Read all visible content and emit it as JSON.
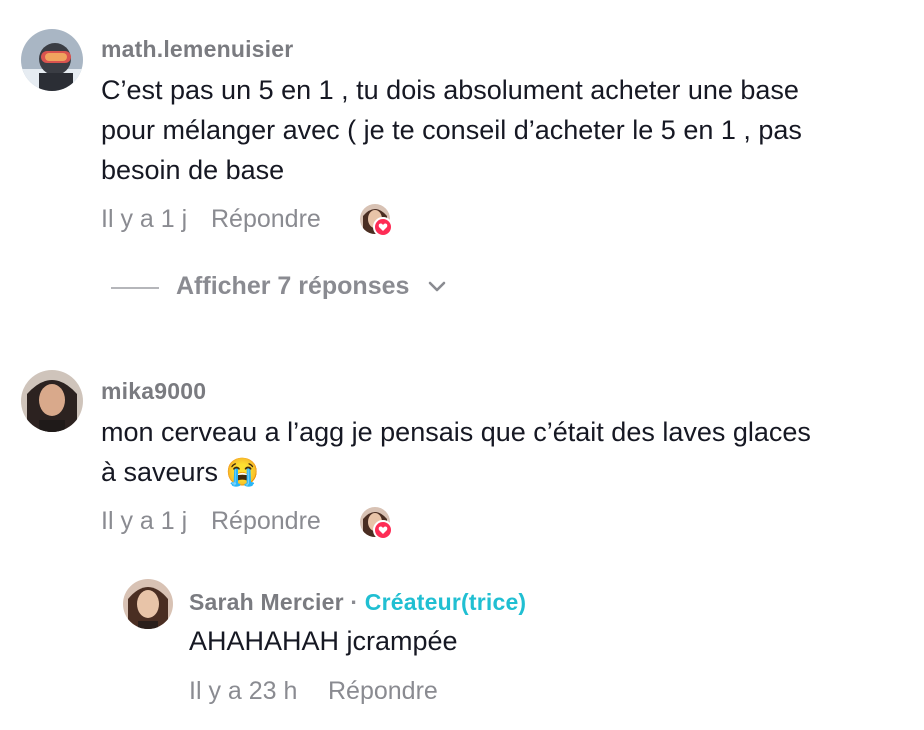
{
  "comments": [
    {
      "username": "math.lemenuisier",
      "text_lines": [
        "C’est pas un 5 en 1 , tu dois absolument acheter une base",
        "pour mélanger avec ( je te conseil d’acheter le 5 en 1 , pas",
        "besoin de base"
      ],
      "time": "Il y a 1 j",
      "reply_label": "Répondre",
      "view_replies": "Afficher 7 réponses"
    },
    {
      "username": "mika9000",
      "text_lines": [
        "mon cerveau a l’agg je pensais que c’était des laves glaces",
        "à saveurs 😭"
      ],
      "time": "Il y a 1 j",
      "reply_label": "Répondre",
      "reply": {
        "username": "Sarah Mercier",
        "separator": " · ",
        "badge": "Créateur(trice)",
        "text": "AHAHAHAH jcrampée",
        "time": "Il y a 23 h",
        "reply_label": "Répondre"
      }
    }
  ],
  "colors": {
    "heart": "#fe2c55",
    "creator": "#20bfd2"
  }
}
